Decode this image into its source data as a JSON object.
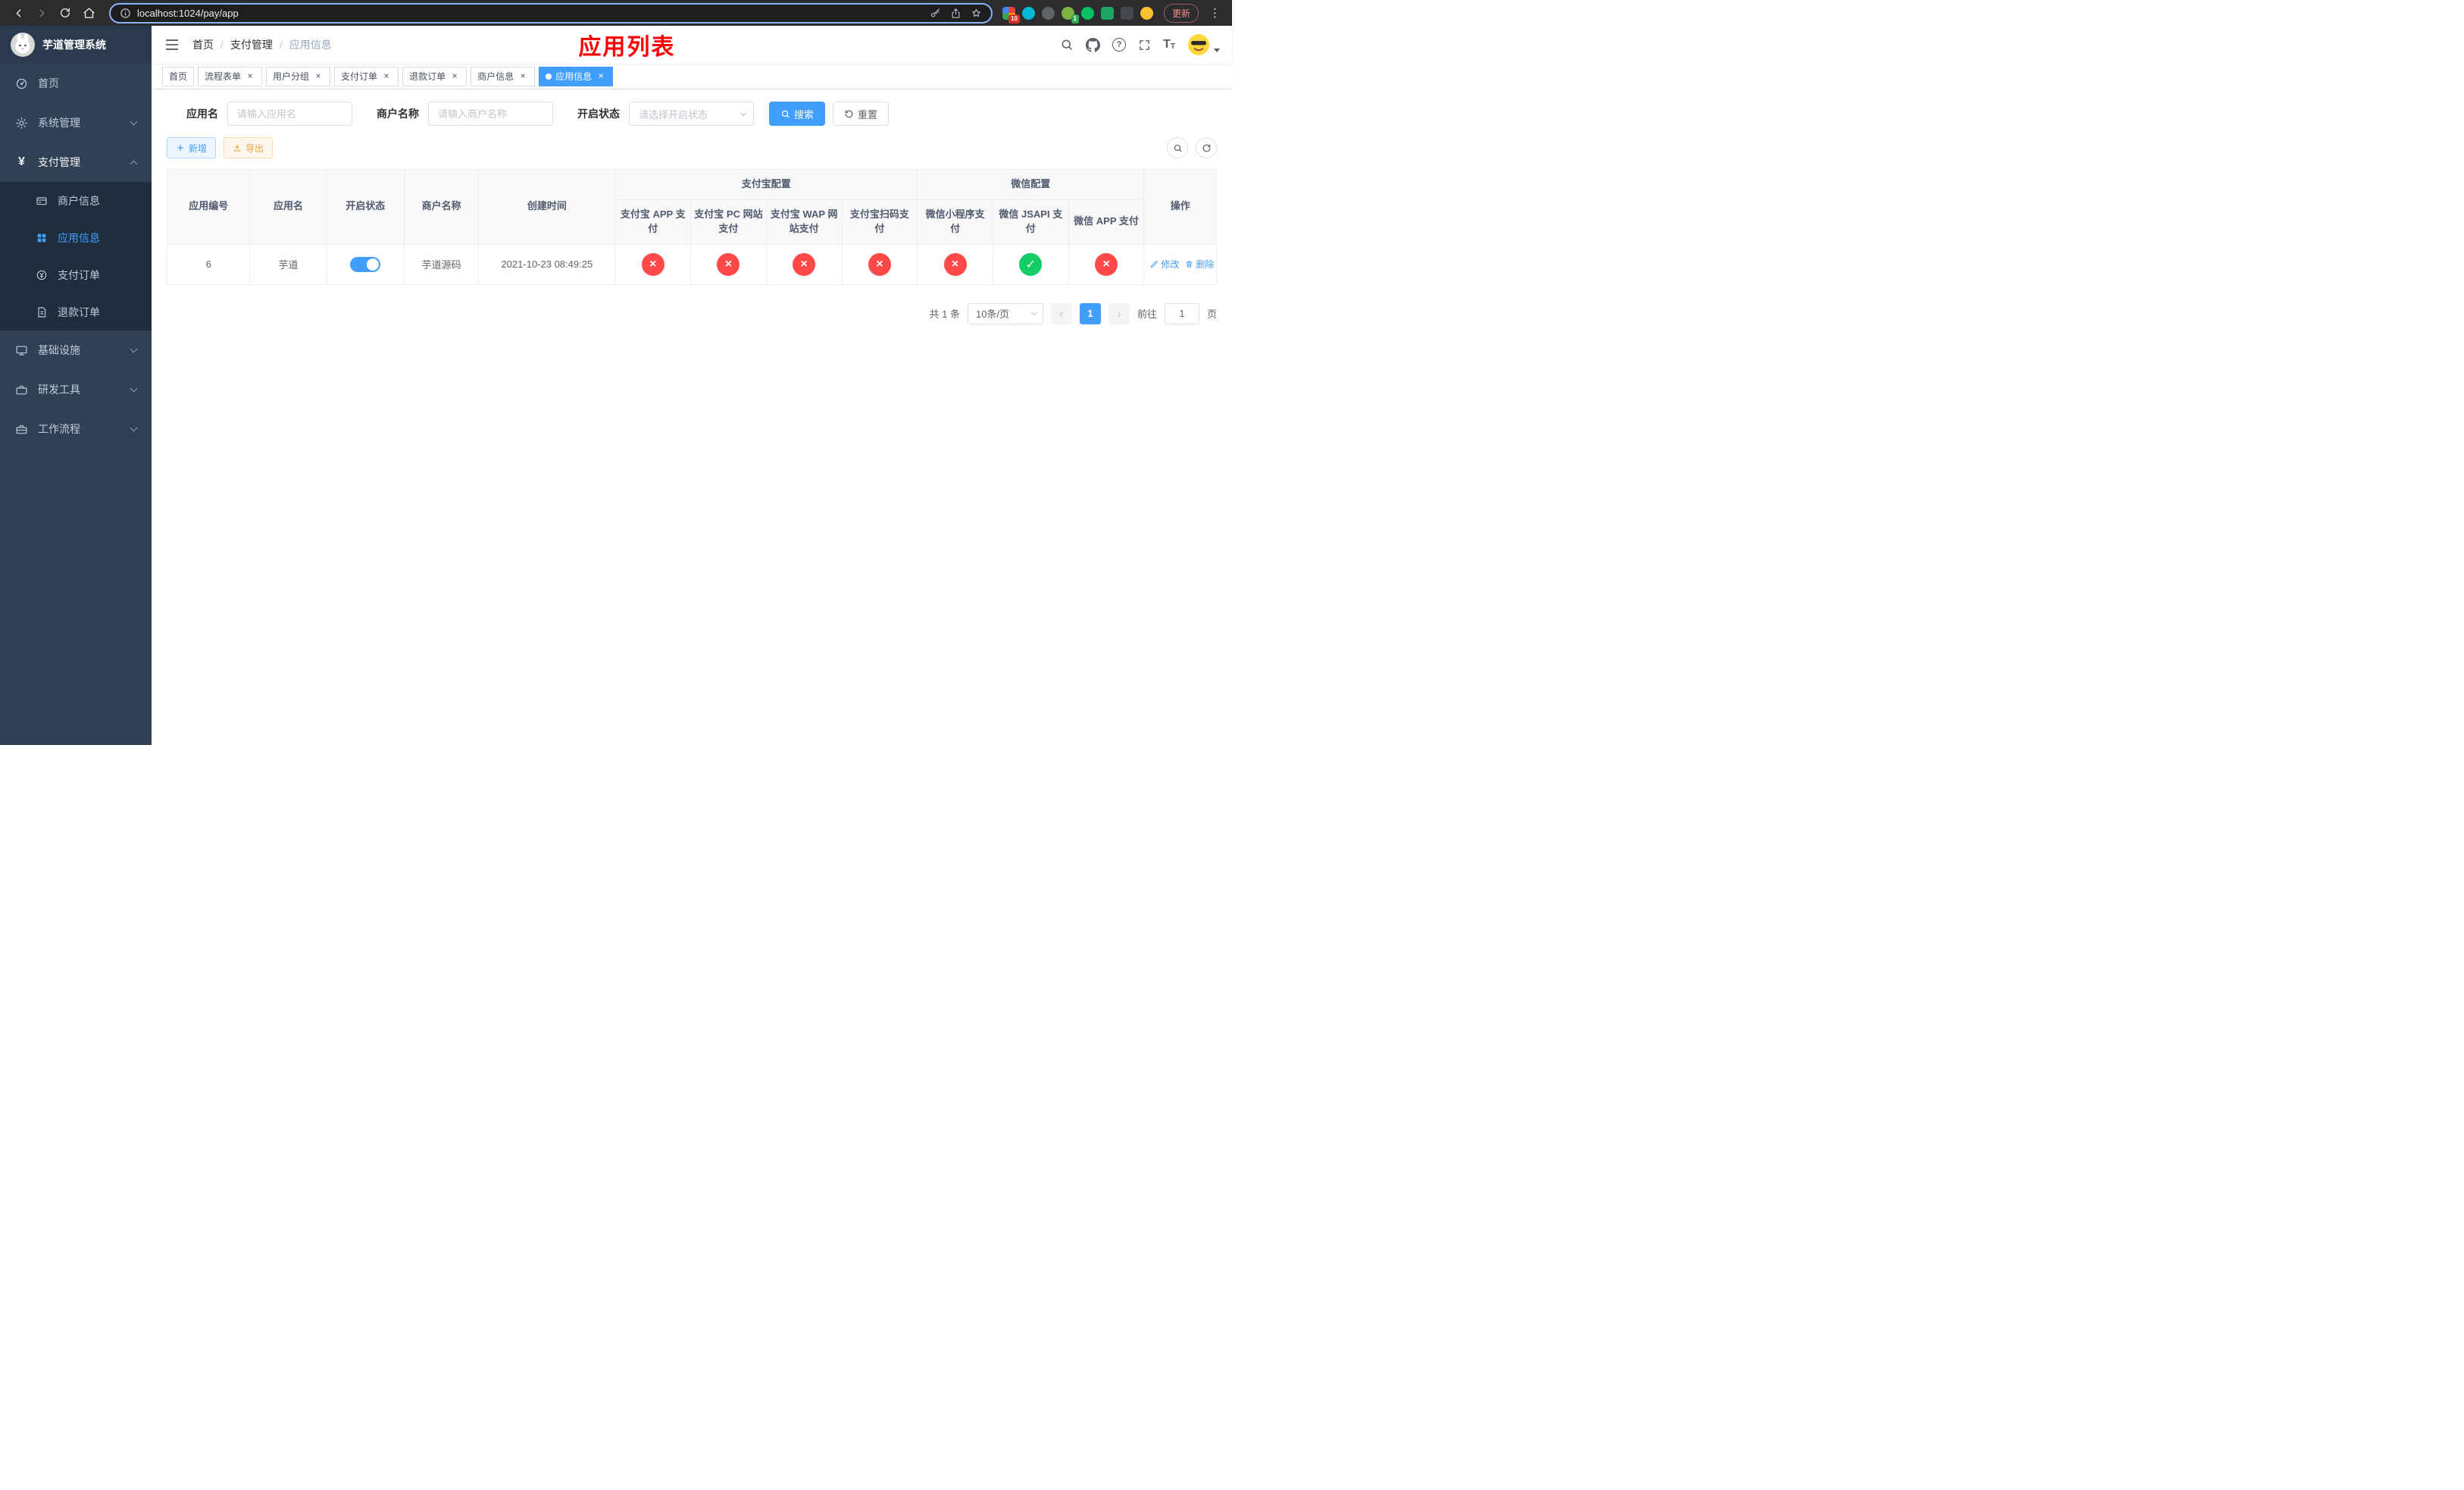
{
  "colors": {
    "primary": "#409eff",
    "success": "#13ce66",
    "danger": "#ff4949",
    "warning": "#e6a23c",
    "title_red": "#ff0000",
    "sidebar_bg": "#304156",
    "submenu_bg": "#1f2d3d"
  },
  "browser": {
    "url": "localhost:1024/pay/app",
    "update_label": "更新",
    "badge_extensions": "10",
    "badge_translate": "1"
  },
  "sidebar": {
    "title": "芋道管理系统",
    "items": [
      {
        "label": "首页"
      },
      {
        "label": "系统管理"
      },
      {
        "label": "支付管理"
      },
      {
        "label": "基础设施"
      },
      {
        "label": "研发工具"
      },
      {
        "label": "工作流程"
      }
    ],
    "payment_children": [
      {
        "label": "商户信息"
      },
      {
        "label": "应用信息"
      },
      {
        "label": "支付订单"
      },
      {
        "label": "退款订单"
      }
    ]
  },
  "navbar": {
    "breadcrumbs": [
      "首页",
      "支付管理",
      "应用信息"
    ],
    "page_title": "应用列表"
  },
  "tabs": [
    {
      "label": "首页",
      "closable": false,
      "active": false
    },
    {
      "label": "流程表单",
      "closable": true,
      "active": false
    },
    {
      "label": "用户分组",
      "closable": true,
      "active": false
    },
    {
      "label": "支付订单",
      "closable": true,
      "active": false
    },
    {
      "label": "退款订单",
      "closable": true,
      "active": false
    },
    {
      "label": "商户信息",
      "closable": true,
      "active": false
    },
    {
      "label": "应用信息",
      "closable": true,
      "active": true
    }
  ],
  "filters": {
    "app_name": {
      "label": "应用名",
      "placeholder": "请输入应用名",
      "value": ""
    },
    "merchant_name": {
      "label": "商户名称",
      "placeholder": "请输入商户名称",
      "value": ""
    },
    "status": {
      "label": "开启状态",
      "placeholder": "请选择开启状态",
      "value": ""
    },
    "search_label": "搜索",
    "reset_label": "重置"
  },
  "toolbar": {
    "add_label": "新增",
    "export_label": "导出"
  },
  "table": {
    "headers": {
      "app_id": "应用编号",
      "app_name": "应用名",
      "status": "开启状态",
      "merchant_name": "商户名称",
      "created_at": "创建时间",
      "alipay_group": "支付宝配置",
      "wechat_group": "微信配置",
      "alipay_app": "支付宝 APP 支付",
      "alipay_pc": "支付宝 PC 网站支付",
      "alipay_wap": "支付宝 WAP 网站支付",
      "alipay_qr": "支付宝扫码支付",
      "wechat_mini": "微信小程序支付",
      "wechat_jsapi": "微信 JSAPI 支付",
      "wechat_app": "微信 APP 支付",
      "actions": "操作"
    },
    "rows": [
      {
        "app_id": "6",
        "app_name": "芋道",
        "status_on": true,
        "merchant_name": "芋道源码",
        "created_at": "2021-10-23 08:49:25",
        "configs": [
          {
            "name": "alipay_app",
            "enabled": false
          },
          {
            "name": "alipay_pc",
            "enabled": false
          },
          {
            "name": "alipay_wap",
            "enabled": false
          },
          {
            "name": "alipay_qr",
            "enabled": false
          },
          {
            "name": "wechat_mini",
            "enabled": false
          },
          {
            "name": "wechat_jsapi",
            "enabled": true
          },
          {
            "name": "wechat_app",
            "enabled": false
          }
        ],
        "actions": [
          "修改",
          "删除"
        ]
      }
    ]
  },
  "pagination": {
    "total_text": "共 1 条",
    "page_size_label": "10条/页",
    "current_page": "1",
    "goto_label": "前往",
    "goto_value": "1",
    "goto_unit": "页"
  },
  "icons": {
    "close": "×",
    "check": "✓",
    "cross": "×",
    "prev": "‹",
    "next": "›",
    "kebab": "⋮",
    "yen": "¥",
    "help": "?",
    "text_size": "T"
  }
}
